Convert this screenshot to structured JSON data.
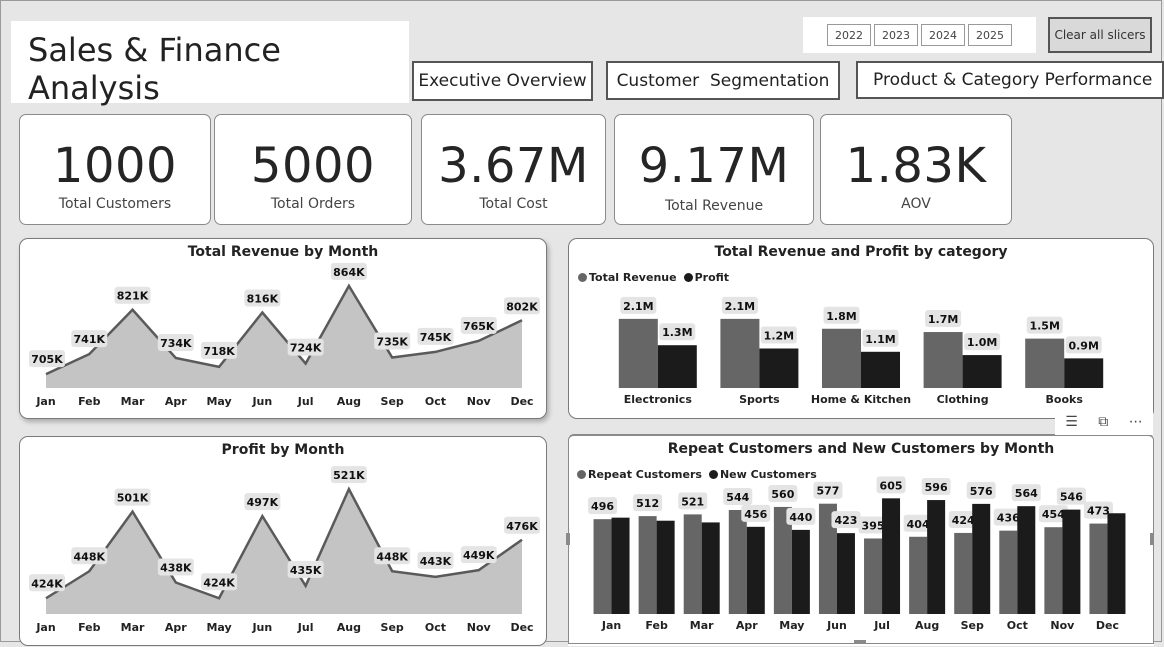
{
  "header": {
    "title": "Sales & Finance Analysis"
  },
  "nav": [
    {
      "label": "Executive Overview"
    },
    {
      "label": "Customer  Segmentation"
    },
    {
      "label": "Product & Category Performance"
    }
  ],
  "slicer": {
    "years": [
      "2022",
      "2023",
      "2024",
      "2025"
    ],
    "clear_label": "Clear all slicers"
  },
  "kpis": [
    {
      "value": "1000",
      "label": "Total Customers"
    },
    {
      "value": "5000",
      "label": "Total Orders"
    },
    {
      "value": "3.67M",
      "label": "Total Cost"
    },
    {
      "value": "9.17M",
      "label": "Total Revenue"
    },
    {
      "value": "1.83K",
      "label": "AOV"
    }
  ],
  "colors": {
    "area_fill": "#c4c4c4",
    "area_line": "#5a5a5a",
    "bar_dark": "#1b1b1b",
    "bar_mid": "#666666",
    "label_bg": "#e4e4e4"
  },
  "chart_data": [
    {
      "type": "area",
      "title": "Total Revenue by Month",
      "categories": [
        "Jan",
        "Feb",
        "Mar",
        "Apr",
        "May",
        "Jun",
        "Jul",
        "Aug",
        "Sep",
        "Oct",
        "Nov",
        "Dec"
      ],
      "values": [
        705,
        741,
        821,
        734,
        718,
        816,
        724,
        864,
        735,
        745,
        765,
        802
      ],
      "data_labels": [
        "705K",
        "741K",
        "821K",
        "734K",
        "718K",
        "816K",
        "724K",
        "864K",
        "735K",
        "745K",
        "765K",
        "802K"
      ],
      "units": "K",
      "ylim": [
        680,
        880
      ]
    },
    {
      "type": "bar",
      "title": "Total Revenue and Profit by category",
      "categories": [
        "Electronics",
        "Sports",
        "Home & Kitchen",
        "Clothing",
        "Books"
      ],
      "series": [
        {
          "name": "Total Revenue",
          "values": [
            2.1,
            2.1,
            1.8,
            1.7,
            1.5
          ],
          "labels": [
            "2.1M",
            "2.1M",
            "1.8M",
            "1.7M",
            "1.5M"
          ],
          "color": "#666666"
        },
        {
          "name": "Profit",
          "values": [
            1.3,
            1.2,
            1.1,
            1.0,
            0.9
          ],
          "labels": [
            "1.3M",
            "1.2M",
            "1.1M",
            "1.0M",
            "0.9M"
          ],
          "color": "#1b1b1b"
        }
      ],
      "legend": "top-left"
    },
    {
      "type": "area",
      "title": "Profit by Month",
      "categories": [
        "Jan",
        "Feb",
        "Mar",
        "Apr",
        "May",
        "Jun",
        "Jul",
        "Aug",
        "Sep",
        "Oct",
        "Nov",
        "Dec"
      ],
      "values": [
        424,
        448,
        501,
        438,
        424,
        497,
        435,
        521,
        448,
        443,
        449,
        476
      ],
      "data_labels": [
        "424K",
        "448K",
        "501K",
        "438K",
        "424K",
        "497K",
        "435K",
        "521K",
        "448K",
        "443K",
        "449K",
        "476K"
      ],
      "units": "K",
      "ylim": [
        410,
        530
      ]
    },
    {
      "type": "bar",
      "title": "Repeat Customers and New Customers by Month",
      "categories": [
        "Jan",
        "Feb",
        "Mar",
        "Apr",
        "May",
        "Jun",
        "Jul",
        "Aug",
        "Sep",
        "Oct",
        "Nov",
        "Dec"
      ],
      "series": [
        {
          "name": "Repeat Customers",
          "values": [
            496,
            512,
            521,
            544,
            560,
            577,
            395,
            404,
            424,
            436,
            454,
            473
          ],
          "labels": [
            "496",
            "512",
            "521",
            "544",
            "560",
            "577",
            "395",
            "404",
            "424",
            "436",
            "454",
            "473"
          ],
          "color": "#666666"
        },
        {
          "name": "New Customers",
          "values": [
            504,
            488,
            479,
            456,
            440,
            423,
            605,
            596,
            576,
            564,
            546,
            527
          ],
          "labels": [
            "",
            "",
            "",
            "456",
            "440",
            "423",
            "605",
            "596",
            "576",
            "564",
            "546",
            ""
          ],
          "color": "#1b1b1b"
        }
      ],
      "legend": "top-left"
    }
  ]
}
